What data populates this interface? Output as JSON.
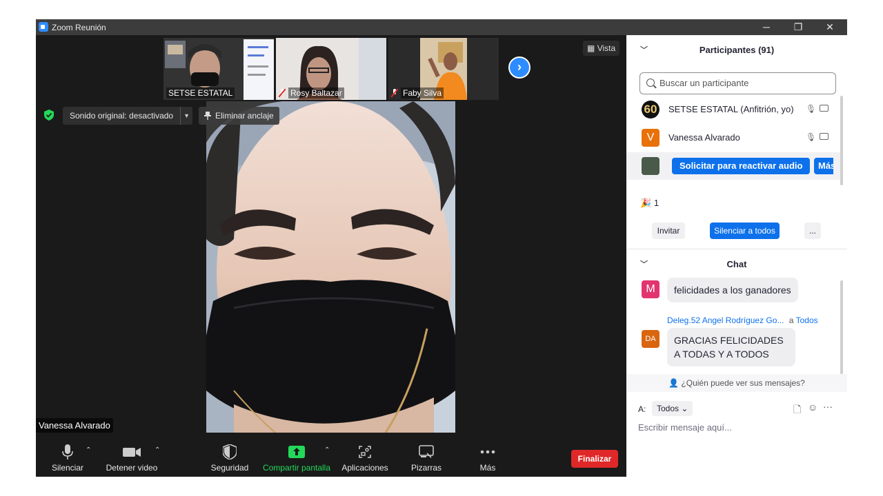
{
  "window": {
    "title": "Zoom Reunión",
    "min": "─",
    "max": "❐",
    "close": "✕"
  },
  "thumbnails": [
    {
      "name": "SETSE ESTATAL"
    },
    {
      "name": "Rosy Baltazar"
    },
    {
      "name": "Faby Silva"
    }
  ],
  "stage": {
    "view_label": "Vista",
    "sound_label": "Sonido original: desactivado",
    "unpin_label": "Eliminar anclaje",
    "active_speaker": "Vanessa Alvarado"
  },
  "toolbar": {
    "mute": "Silenciar",
    "stop_video": "Detener video",
    "security": "Seguridad",
    "share": "Compartir pantalla",
    "apps": "Aplicaciones",
    "whiteboards": "Pizarras",
    "more": "Más",
    "end": "Finalizar"
  },
  "participants": {
    "header": "Participantes (91)",
    "search_placeholder": "Buscar un participante",
    "list": [
      {
        "name": "SETSE ESTATAL (Anfitrión, yo)",
        "avatar_text": "60"
      },
      {
        "name": "Vanessa Alvarado",
        "avatar_text": "V"
      }
    ],
    "request_unmute": "Solicitar para reactivar audio",
    "more_btn": "Más",
    "reactions_count": "1",
    "invite": "Invitar",
    "mute_all": "Silenciar a todos",
    "ellipsis": "..."
  },
  "chat": {
    "header": "Chat",
    "messages": [
      {
        "avatar": "M",
        "text": "felicidades a los ganadores"
      },
      {
        "sender": "Deleg.52 Angel Rodríguez Go...",
        "to_prefix": "a",
        "to": "Todos",
        "avatar": "DA",
        "text": "GRACIAS FELICIDADES A TODAS Y A TODOS"
      }
    ],
    "who_can_see": "¿Quién puede ver sus mensajes?",
    "to_label": "A:",
    "to_value": "Todos",
    "input_placeholder": "Escribir mensaje aquí..."
  },
  "colors": {
    "accent": "#0e71eb",
    "end": "#e02828",
    "share": "#23d959",
    "avatar_orange": "#e8710a",
    "avatar_pink": "#e2356f"
  }
}
